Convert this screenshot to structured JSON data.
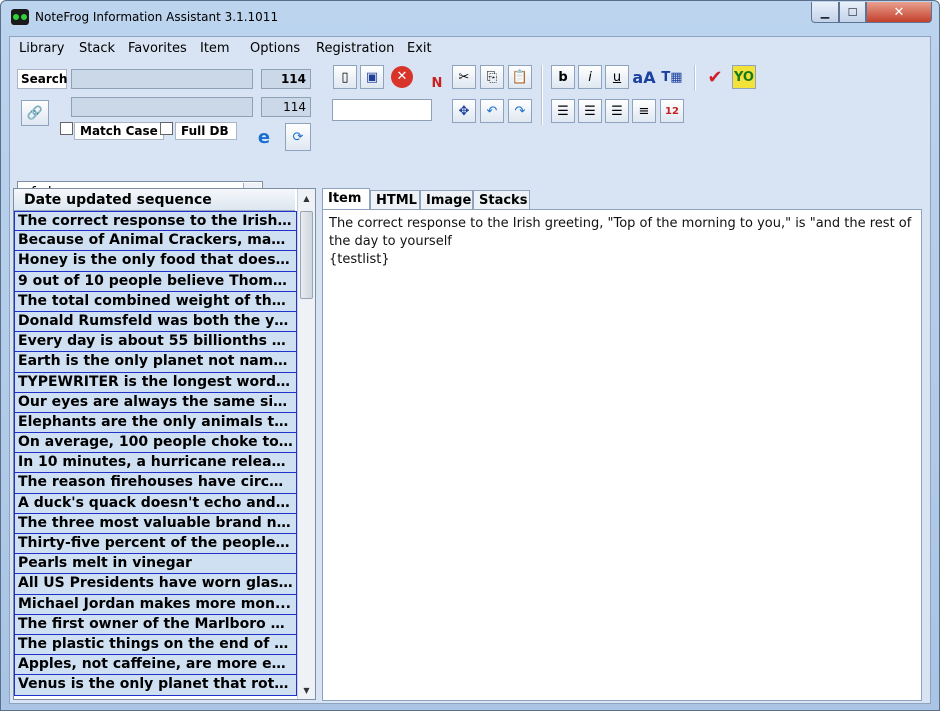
{
  "window": {
    "title": "NoteFrog Information Assistant 3.1.1011"
  },
  "menu": [
    "Library",
    "Stack",
    "Favorites",
    "Item",
    "Options",
    "Registration",
    "Exit"
  ],
  "search": {
    "label": "Search",
    "value": "",
    "count": "114",
    "count2": "114",
    "match_case": "Match Case",
    "full_db": "Full DB"
  },
  "library": {
    "selected": "nf_demo"
  },
  "list": {
    "header": "Date updated sequence",
    "items": [
      "The correct response to the Irish g...",
      "Because of Animal Crackers, man...",
      "Honey is the only food that does n...",
      "9 out of 10 people believe Thoma...",
      "The total combined weight of the ...",
      "Donald Rumsfeld was both the yo...",
      "Every day is about 55 billionths of ...",
      "Earth is the only planet not name...",
      "TYPEWRITER is the longest word t...",
      "Our eyes are always the same siz...",
      "Elephants are the only animals th...",
      "On average, 100 people choke to ...",
      "In 10 minutes, a hurricane release...",
      "The reason firehouses have circul...",
      "A duck's quack doesn't echo and ...",
      "The three most valuable brand na...",
      "Thirty-five percent of the people ...",
      "Pearls melt in vinegar",
      "All US Presidents have worn glass...",
      "Michael Jordan makes more mon...",
      "The first owner of the Marlboro Co...",
      "The plastic things on the end of sh...",
      "Apples, not caffeine, are more effi...",
      "Venus is the only planet that rotat..."
    ]
  },
  "tabs": [
    "Item",
    "HTML",
    "Image",
    "Stacks"
  ],
  "editor": {
    "line1": "The correct response to the Irish greeting, \"Top of the morning to you,\" is \"and the rest of",
    "line2": "the day to yourself",
    "line3": "{testlist}"
  },
  "colors": {
    "list_bg": "#cfe0f3",
    "list_border": "#2030c8",
    "chrome": "#d8e4f3"
  }
}
